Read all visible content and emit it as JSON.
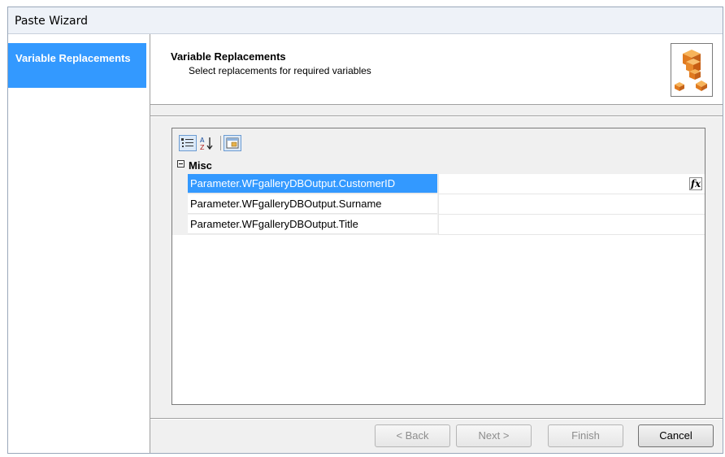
{
  "window": {
    "title": "Paste Wizard"
  },
  "nav": {
    "items": [
      {
        "label": "Variable Replacements",
        "selected": true
      }
    ]
  },
  "header": {
    "title": "Variable Replacements",
    "subtitle": "Select replacements for required variables",
    "icon": "cubes-icon"
  },
  "toolbar": {
    "buttons": [
      "categorized-view-icon",
      "alphabetical-sort-icon",
      "property-pages-icon"
    ]
  },
  "grid": {
    "category": "Misc",
    "rows": [
      {
        "name": "Parameter.WFgalleryDBOutput.CustomerID",
        "value": "",
        "selected": true
      },
      {
        "name": "Parameter.WFgalleryDBOutput.Surname",
        "value": "",
        "selected": false
      },
      {
        "name": "Parameter.WFgalleryDBOutput.Title",
        "value": "",
        "selected": false
      }
    ]
  },
  "buttons": {
    "back": "< Back",
    "next": "Next >",
    "finish": "Finish",
    "cancel": "Cancel"
  },
  "colors": {
    "selection": "#3399ff",
    "panel": "#f0f0f0",
    "accent_orange": "#e8892b"
  }
}
